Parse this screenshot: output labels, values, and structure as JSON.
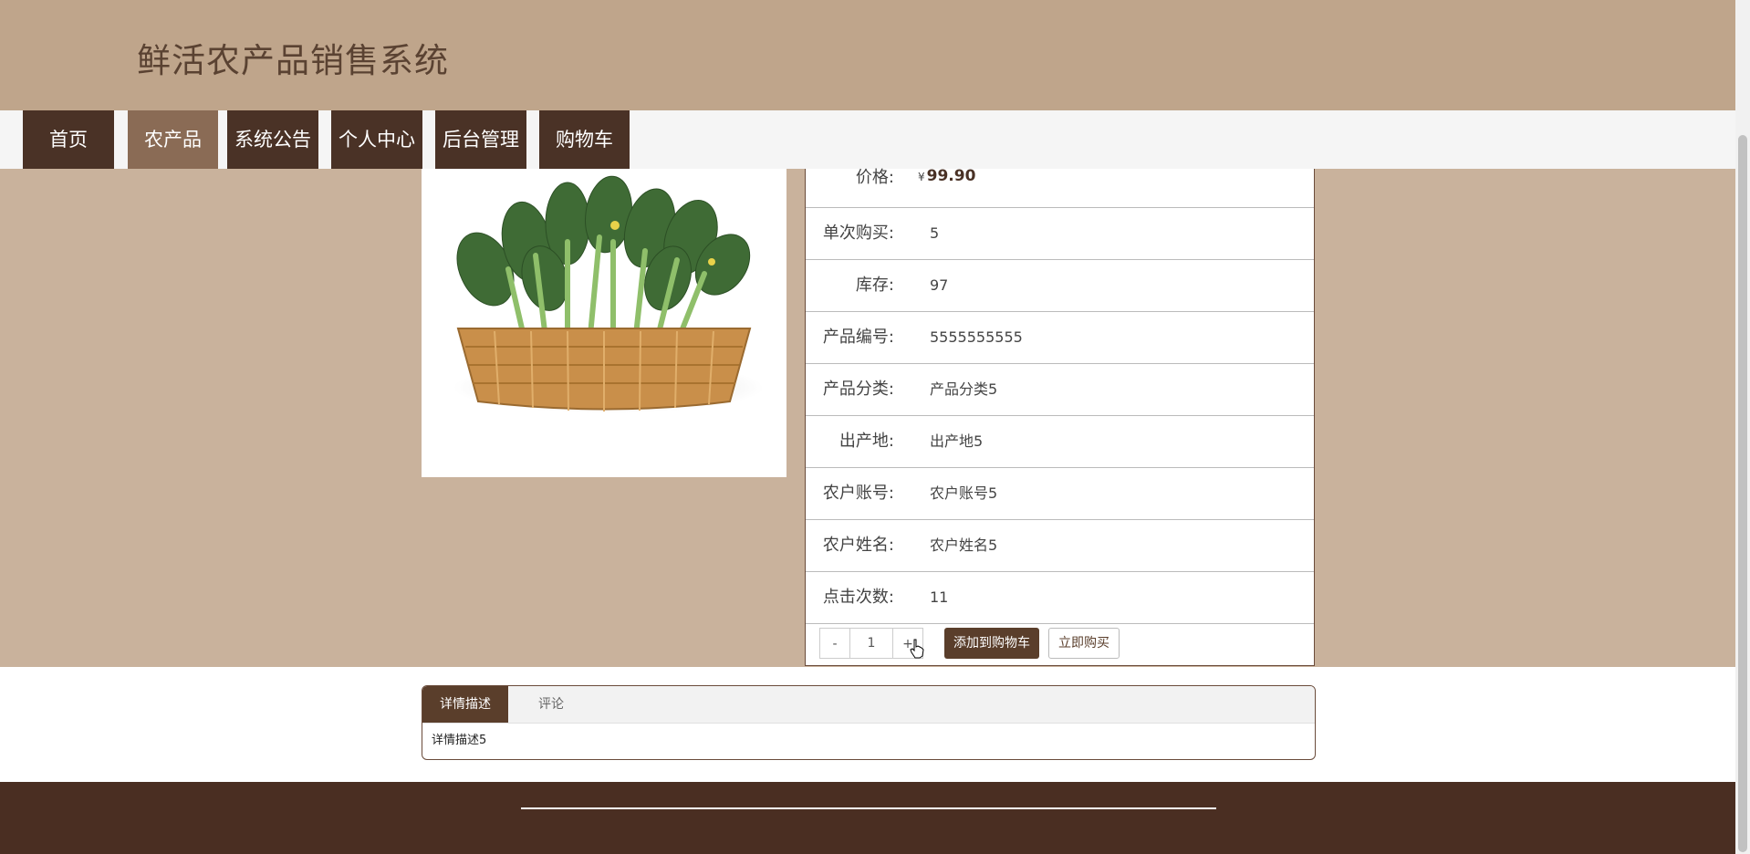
{
  "site": {
    "title": "鲜活农产品销售系统"
  },
  "nav": {
    "items": [
      {
        "label": "首页",
        "active": false
      },
      {
        "label": "农产品",
        "active": true
      },
      {
        "label": "系统公告",
        "active": false
      },
      {
        "label": "个人中心",
        "active": false
      },
      {
        "label": "后台管理",
        "active": false
      },
      {
        "label": "购物车",
        "active": false
      }
    ]
  },
  "product": {
    "image_icon": "vegetable-basket-icon",
    "price_label": "价格:",
    "price_currency": "¥",
    "price_value": "99.90",
    "fields": [
      {
        "label": "单次购买:",
        "value": "5"
      },
      {
        "label": "库存:",
        "value": "97"
      },
      {
        "label": "产品编号:",
        "value": "5555555555"
      },
      {
        "label": "产品分类:",
        "value": "产品分类5"
      },
      {
        "label": "出产地:",
        "value": "出产地5"
      },
      {
        "label": "农户账号:",
        "value": "农户账号5"
      },
      {
        "label": "农户姓名:",
        "value": "农户姓名5"
      },
      {
        "label": "点击次数:",
        "value": "11"
      }
    ]
  },
  "purchase": {
    "minus_label": "-",
    "quantity": "1",
    "plus_label": "+",
    "add_to_cart_label": "添加到购物车",
    "buy_now_label": "立即购买"
  },
  "tabs": {
    "items": [
      {
        "label": "详情描述",
        "active": true
      },
      {
        "label": "评论",
        "active": false
      }
    ],
    "content": "详情描述5"
  },
  "colors": {
    "header_bg": "#bfa58b",
    "band_bg": "#c9b29c",
    "nav_bg": "#4a3226",
    "nav_active_bg": "#8a6b55",
    "footer_bg": "#4a2e22"
  }
}
